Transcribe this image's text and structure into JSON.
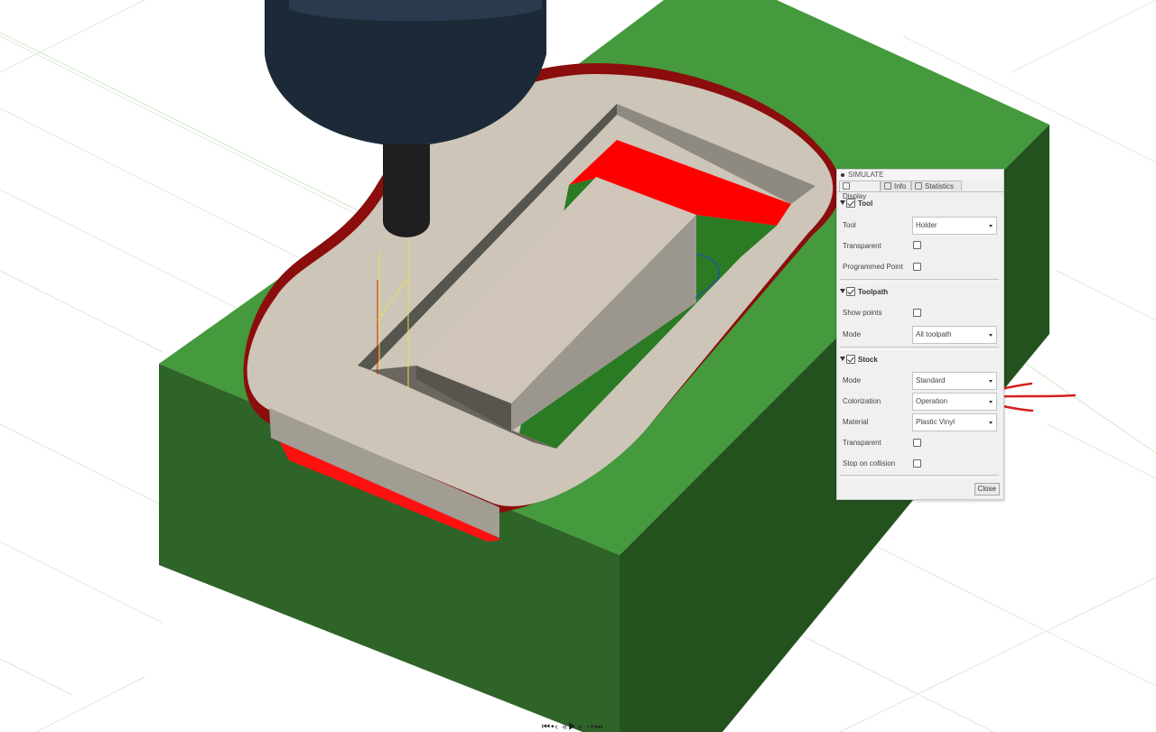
{
  "panel": {
    "title": "SIMULATE",
    "tabs": [
      {
        "label": "Display",
        "active": true
      },
      {
        "label": "Info",
        "active": false
      },
      {
        "label": "Statistics",
        "active": false
      }
    ],
    "tool_section": {
      "header": "Tool",
      "checked": true,
      "tool_label": "Tool",
      "tool_value": "Holder",
      "transparent_label": "Transparent",
      "programmed_point_label": "Programmed Point"
    },
    "toolpath_section": {
      "header": "Toolpath",
      "checked": true,
      "show_points_label": "Show points",
      "mode_label": "Mode",
      "mode_value": "All toolpath"
    },
    "stock_section": {
      "header": "Stock",
      "checked": true,
      "mode_label": "Mode",
      "mode_value": "Standard",
      "colorization_label": "Colorization",
      "colorization_value": "Operation",
      "material_label": "Material",
      "material_value": "Plastic Vinyl",
      "transparent_label": "Transparent",
      "stop_on_collision_label": "Stop on collision"
    },
    "close_label": "Close"
  },
  "playback_icons": [
    "skip-start-icon",
    "prev-keyframe-icon",
    "step-back-icon",
    "play-icon",
    "step-forward-icon",
    "next-keyframe-icon",
    "skip-end-icon"
  ],
  "colors": {
    "stock_green": "#3f973a",
    "stock_green_dark": "#2b5f24",
    "collision_red": "#ff0000",
    "edge_dark_red": "#8b0000",
    "part_beige": "#cfc6b9",
    "tool_holder": "#1b2836",
    "annotation_arrow": "#d42020"
  }
}
